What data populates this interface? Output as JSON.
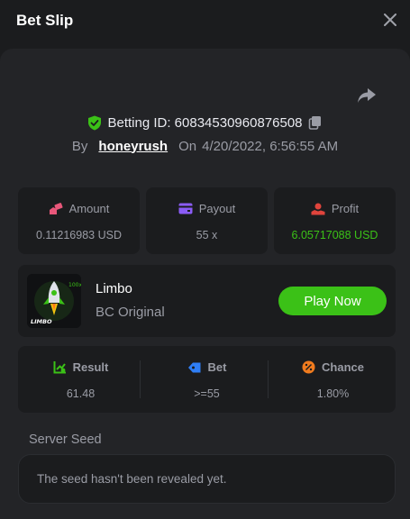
{
  "header": {
    "title": "Bet Slip",
    "close_icon": "close-icon"
  },
  "bet_info": {
    "share_icon": "share-icon",
    "betting_id_label": "Betting ID: 608345309608765​08",
    "by_label": "By",
    "username": "honeyrush",
    "on_label": "On",
    "datetime": "4/20/2022, 6:56:55 AM"
  },
  "stats": {
    "amount": {
      "label": "Amount",
      "value": "0.11216983 USD",
      "icon": "coins-icon",
      "color": "#e8577a"
    },
    "payout": {
      "label": "Payout",
      "value": "55 x",
      "icon": "wallet-icon",
      "color": "#8b5cf6"
    },
    "profit": {
      "label": "Profit",
      "value": "6.05717088 USD",
      "icon": "hand-coin-icon",
      "color": "#e0443c",
      "value_color": "#3bc117"
    }
  },
  "game": {
    "name": "Limbo",
    "provider": "BC Original",
    "thumb_label": "LIMBO",
    "play_label": "Play Now"
  },
  "result": {
    "result": {
      "label": "Result",
      "value": "61.48",
      "icon": "chart-up-icon",
      "color": "#3bc117"
    },
    "bet": {
      "label": "Bet",
      "value": ">=55",
      "icon": "tag-icon",
      "color": "#2f7ef5"
    },
    "chance": {
      "label": "Chance",
      "value": "1.80%",
      "icon": "percent-icon",
      "color": "#f07b1e"
    }
  },
  "seed": {
    "label": "Server Seed",
    "message": "The seed hasn't been revealed yet."
  }
}
